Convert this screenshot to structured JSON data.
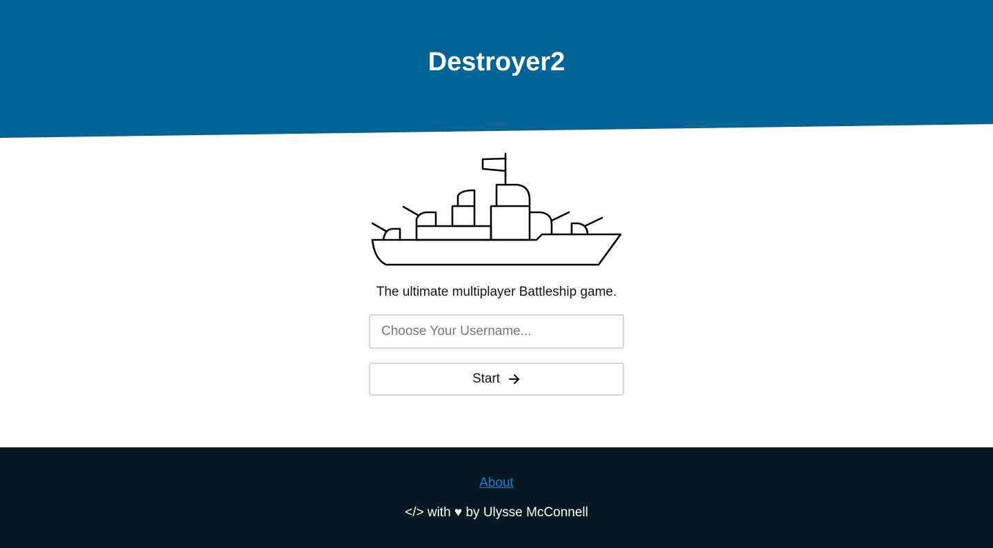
{
  "header": {
    "title": "Destroyer2",
    "bg_color": "#006496"
  },
  "hero": {
    "ship_icon": "battleship-icon",
    "tagline": "The ultimate multiplayer Battleship game."
  },
  "form": {
    "username_placeholder": "Choose Your Username...",
    "username_value": "",
    "start_label": "Start",
    "start_icon": "arrow-right-icon"
  },
  "footer": {
    "bg_color": "#061923",
    "about_label": "About",
    "credit_text": "</> with ♥ by Ulysse McConnell",
    "link_color": "#1f7fce"
  }
}
